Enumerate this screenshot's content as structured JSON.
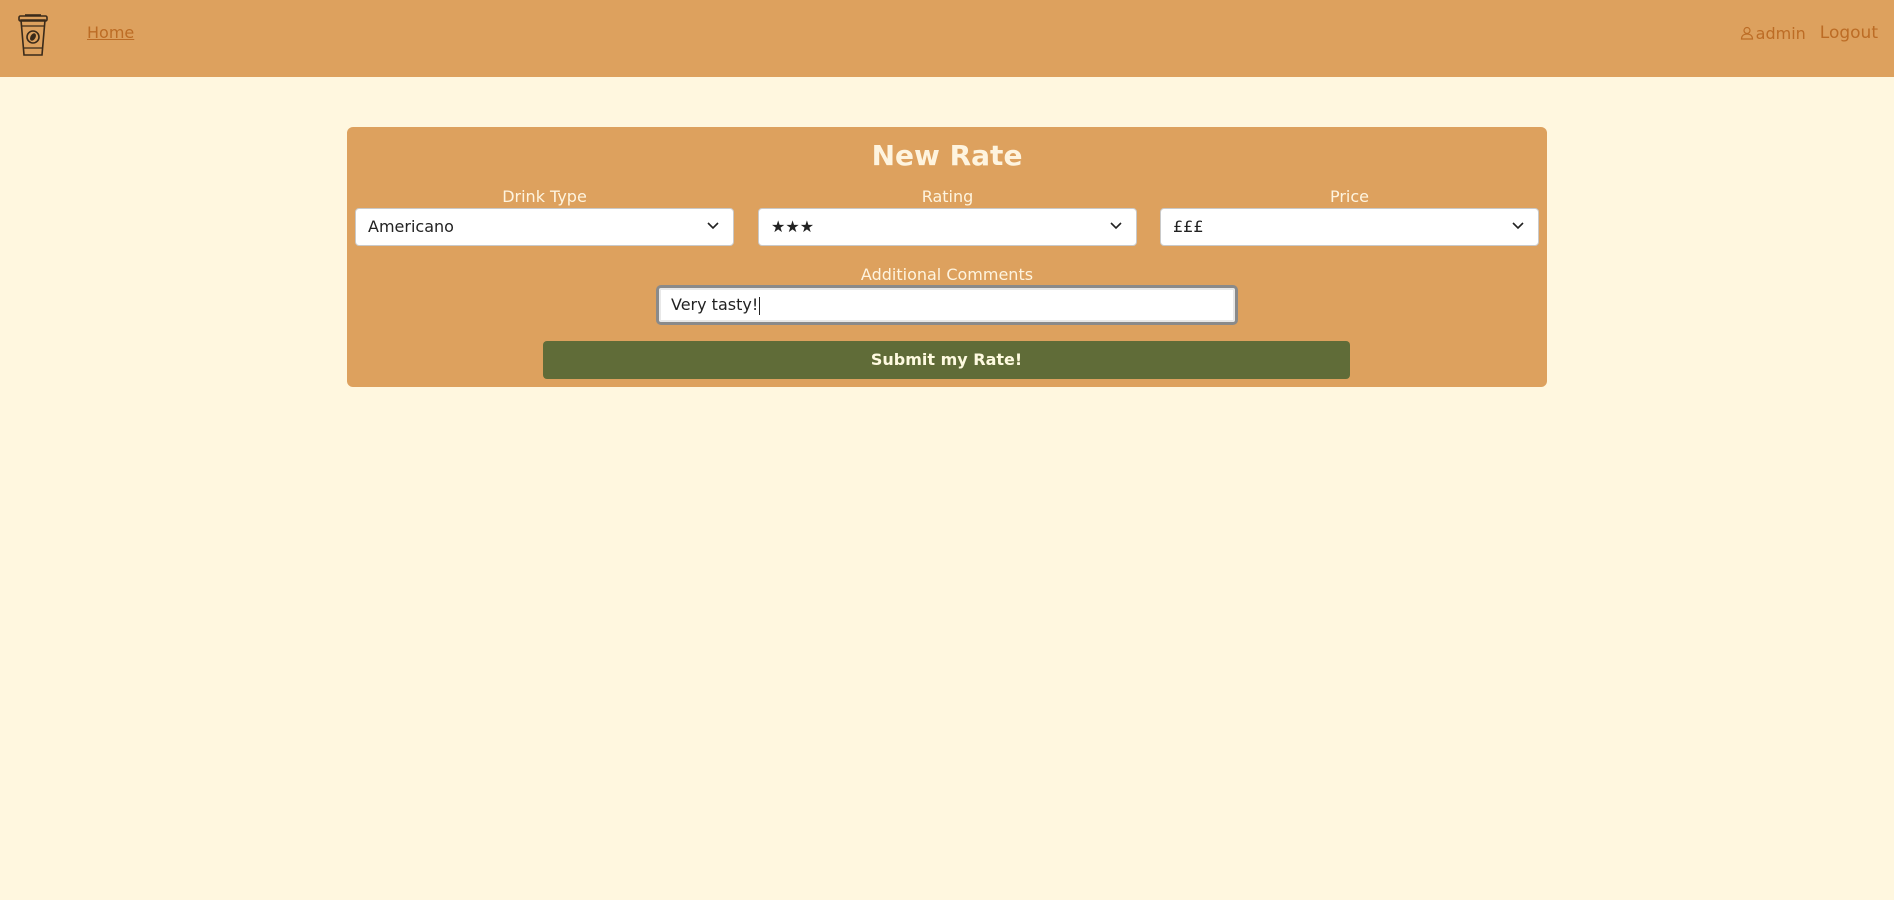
{
  "nav": {
    "logo_icon": "coffee-cup-logo-icon",
    "home_label": "Home",
    "user_icon": "user-icon",
    "username": "admin",
    "logout_label": "Logout"
  },
  "form": {
    "title": "New Rate",
    "drink_type": {
      "label": "Drink Type",
      "selected": "Americano"
    },
    "rating": {
      "label": "Rating",
      "selected": "★★★"
    },
    "price": {
      "label": "Price",
      "selected": "£££"
    },
    "comments": {
      "label": "Additional Comments",
      "value": "Very tasty!"
    },
    "submit_label": "Submit my Rate!"
  },
  "colors": {
    "page_background": "#fff7df",
    "header_background": "#dda15e",
    "link_color": "#bc6c25",
    "submit_background": "#606c38"
  }
}
